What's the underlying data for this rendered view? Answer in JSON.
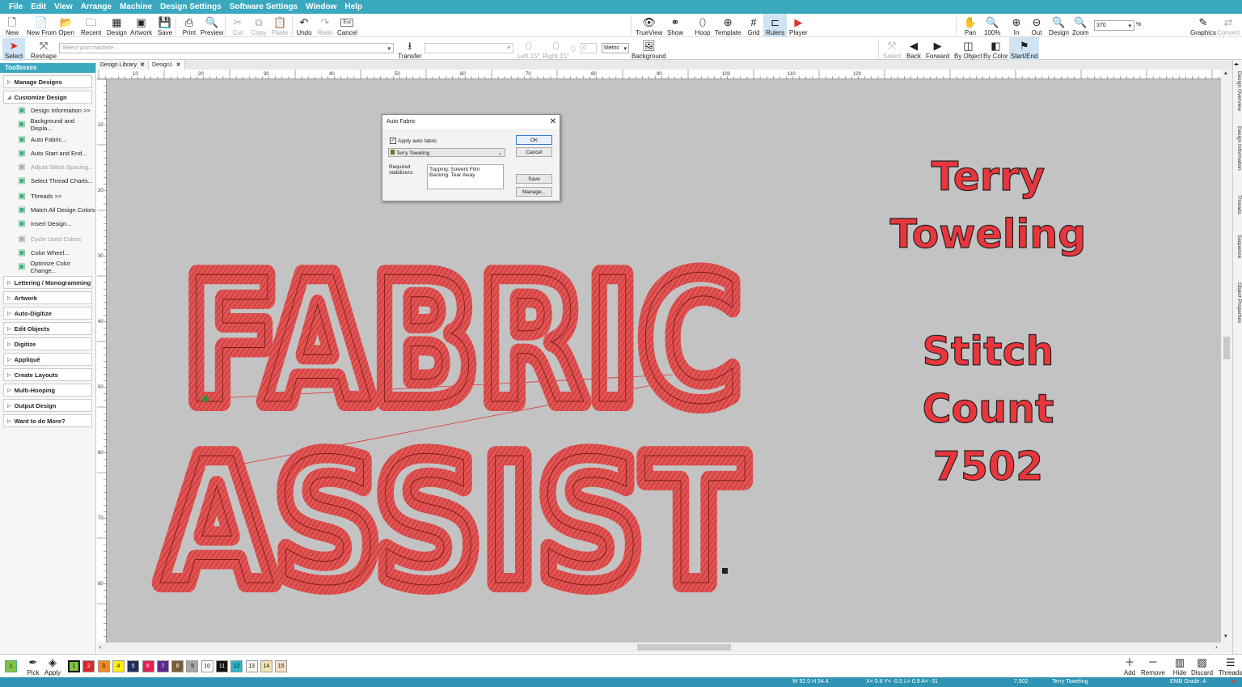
{
  "menu": [
    "File",
    "Edit",
    "View",
    "Arrange",
    "Machine",
    "Design Settings",
    "Software Settings",
    "Window",
    "Help"
  ],
  "toolbar1": {
    "new": "New",
    "new_from": "New From",
    "open": "Open",
    "recent": "Recent",
    "design": "Design",
    "artwork": "Artwork",
    "save": "Save",
    "print": "Print",
    "preview": "Preview",
    "cut": "Cut",
    "copy": "Copy",
    "paste": "Paste",
    "undo": "Undo",
    "redo": "Redo",
    "cancel": "Cancel",
    "cancel_key": "Esc",
    "trueview": "TrueView",
    "show": "Show",
    "hoop": "Hoop",
    "template": "Template",
    "grid": "Grid",
    "rulers": "Rulers",
    "player": "Player",
    "pan": "Pan",
    "zoom100": "100%",
    "zoom_in": "In",
    "zoom_out": "Out",
    "zoom_design": "Design",
    "zoom": "Zoom",
    "zoom_value": "370",
    "zoom_unit": "%",
    "graphics": "Graphics",
    "convert": "Convert"
  },
  "toolbar2": {
    "select": "Select",
    "reshape": "Reshape",
    "machine_placeholder": "Select your machine...",
    "transfer": "Transfer",
    "left15": "Left 15°",
    "right15": "Right 15°",
    "rotate_value": "0",
    "units": "Metric",
    "background": "Background",
    "seq_select": "Select",
    "back": "Back",
    "forward": "Forward",
    "by_object": "By Object",
    "by_color": "By Color",
    "start_end": "Start/End"
  },
  "sidebar": {
    "title": "Toolboxes",
    "manage": "Manage Designs",
    "customize": "Customize Design",
    "items": [
      {
        "label": "Design Information >>",
        "icon": "info-icon",
        "dis": false
      },
      {
        "label": "Background and Displa...",
        "icon": "background-icon",
        "dis": false
      },
      {
        "label": "Auto Fabric...",
        "icon": "fabric-icon",
        "dis": false
      },
      {
        "label": "Auto Start and End...",
        "icon": "start-end-icon",
        "dis": false
      },
      {
        "label": "Adjust Stitch Spacing...",
        "icon": "spacing-icon",
        "dis": true
      },
      {
        "label": "Select Thread Charts...",
        "icon": "thread-chart-icon",
        "dis": false
      },
      {
        "label": "Threads >>",
        "icon": "threads-icon",
        "dis": false
      },
      {
        "label": "Match All Design Colors",
        "icon": "match-colors-icon",
        "dis": false
      },
      {
        "label": "Insert Design...",
        "icon": "insert-icon",
        "dis": false
      },
      {
        "label": "Cycle Used Colors",
        "icon": "cycle-icon",
        "dis": true
      },
      {
        "label": "Color Wheel...",
        "icon": "color-wheel-icon",
        "dis": false
      },
      {
        "label": "Optimize Color Change...",
        "icon": "optimize-icon",
        "dis": false
      }
    ],
    "sections": [
      "Lettering / Monogramming",
      "Artwork",
      "Auto-Digitize",
      "Edit Objects",
      "Digitize",
      "Appliqué",
      "Create Layouts",
      "Multi-Hooping",
      "Output Design",
      "Want to do More?"
    ]
  },
  "tabs": [
    {
      "label": "Design Library",
      "active": false
    },
    {
      "label": "Design1",
      "active": true
    }
  ],
  "ruler": {
    "h": [
      "10",
      "20",
      "30",
      "40",
      "50",
      "60",
      "70",
      "80",
      "90",
      "100",
      "110",
      "120"
    ],
    "v": [
      "10",
      "20",
      "30",
      "40",
      "50",
      "60",
      "70",
      "80"
    ]
  },
  "dialog": {
    "title": "Auto Fabric",
    "apply_label": "Apply auto fabric",
    "fabric": "Terry Toweling",
    "required": "Required stabilizers:",
    "topping": "Topping: Solvent Film",
    "backing": "Backing: Tear Away",
    "ok": "OK",
    "cancel": "Cancel",
    "save": "Save",
    "manage": "Manage..."
  },
  "design_text": {
    "line1": "FABRIC",
    "line2": "ASSIST"
  },
  "overlay": {
    "fabric1": "Terry",
    "fabric2": "Toweling",
    "stitch1": "Stitch",
    "stitch2": "Count",
    "count": "7502"
  },
  "right_tabs": [
    "Design Overview",
    "Design Information",
    "Threads",
    "Sequence",
    "Object Properties"
  ],
  "colors": {
    "accent": "#3aa9c0",
    "stitch": "#d92b2b"
  },
  "bottom": {
    "pick": "Pick",
    "apply": "Apply",
    "swatches": [
      {
        "n": "1",
        "c": "#7fc242"
      },
      {
        "n": "2",
        "c": "#d9262c"
      },
      {
        "n": "3",
        "c": "#f28a1f"
      },
      {
        "n": "4",
        "c": "#fff200"
      },
      {
        "n": "5",
        "c": "#1c2f5c"
      },
      {
        "n": "6",
        "c": "#e51e4f"
      },
      {
        "n": "7",
        "c": "#5b2a8e"
      },
      {
        "n": "8",
        "c": "#7b5a3a"
      },
      {
        "n": "9",
        "c": "#a7a7a7"
      },
      {
        "n": "10",
        "c": "#ffffff"
      },
      {
        "n": "11",
        "c": "#111111"
      },
      {
        "n": "12",
        "c": "#29b6c9"
      },
      {
        "n": "13",
        "c": "#f7f7f0"
      },
      {
        "n": "14",
        "c": "#f4e2b0"
      },
      {
        "n": "15",
        "c": "#f6dec9"
      }
    ],
    "add": "Add",
    "remove": "Remove",
    "hide": "Hide",
    "discard": "Discard",
    "threads": "Threads"
  },
  "status": {
    "wh": "W 92.0 H 54.4",
    "xy": "X= 0.8 Y= -0.5 L= 0.9 A= -31",
    "stitches": "7,502",
    "fabric": "Terry Toweling",
    "grade": "EMB Grade: A"
  }
}
